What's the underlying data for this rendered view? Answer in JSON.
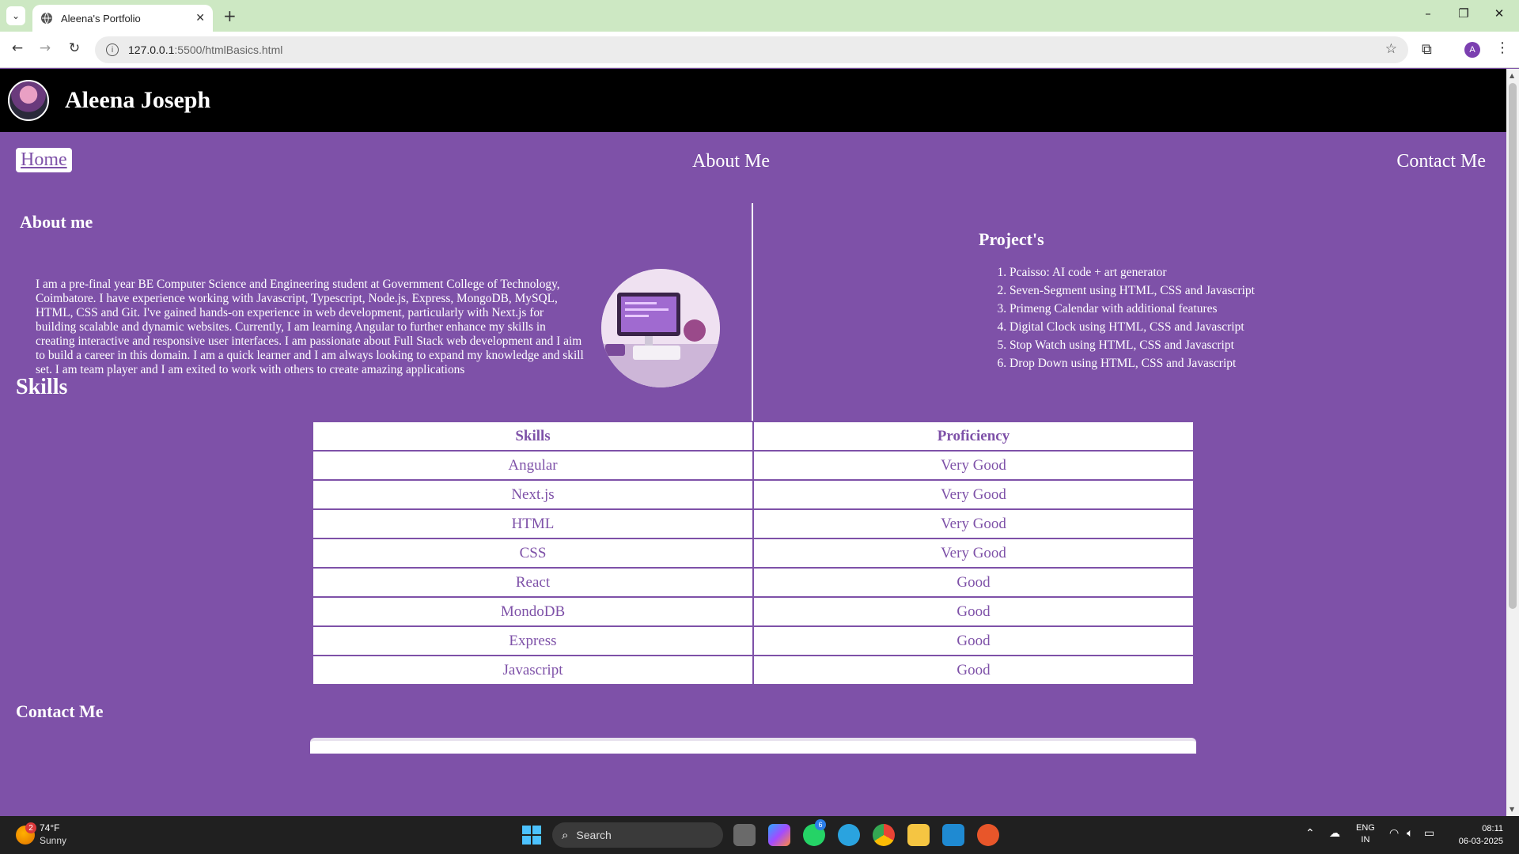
{
  "browser": {
    "tab_title": "Aleena's Portfolio",
    "new_tab": "+",
    "url_host": "127.0.0.1",
    "url_path": ":5500/htmlBasics.html",
    "profile_initial": "A"
  },
  "header": {
    "name": "Aleena Joseph"
  },
  "nav": {
    "home": "Home",
    "about": "About Me",
    "contact": "Contact Me"
  },
  "about": {
    "title": "About me",
    "text": "I am a pre-final year BE Computer Science and Engineering student at Government College of Technology, Coimbatore. I have experience working with Javascript, Typescript, Node.js, Express, MongoDB, MySQL, HTML, CSS and Git. I've gained hands-on experience in web development, particularly with Next.js for building scalable and dynamic websites. Currently, I am learning Angular to further enhance my skills in creating interactive and responsive user interfaces. I am passionate about Full Stack web development and I aim to build a career in this domain. I am a quick learner and I am always looking to expand my knowledge and skill set. I am team player and I am exited to work with others to create amazing applications"
  },
  "projects": {
    "title": "Project's",
    "items": [
      "Pcaisso: AI code + art generator",
      "Seven-Segment using HTML, CSS and Javascript",
      "Primeng Calendar with additional features",
      "Digital Clock using HTML, CSS and Javascript",
      "Stop Watch using HTML, CSS and Javascript",
      "Drop Down using HTML, CSS and Javascript"
    ]
  },
  "skills": {
    "title": "Skills",
    "headers": [
      "Skills",
      "Proficiency"
    ],
    "rows": [
      [
        "Angular",
        "Very Good"
      ],
      [
        "Next.js",
        "Very Good"
      ],
      [
        "HTML",
        "Very Good"
      ],
      [
        "CSS",
        "Very Good"
      ],
      [
        "React",
        "Good"
      ],
      [
        "MondoDB",
        "Good"
      ],
      [
        "Express",
        "Good"
      ],
      [
        "Javascript",
        "Good"
      ]
    ]
  },
  "contact": {
    "title": "Contact Me"
  },
  "taskbar": {
    "weather_badge": "2",
    "weather_temp": "74°F",
    "weather_desc": "Sunny",
    "search_label": "Search",
    "whatsapp_badge": "6",
    "lang_line1": "ENG",
    "lang_line2": "IN",
    "time": "08:11",
    "date": "06-03-2025"
  },
  "colors": {
    "page_bg": "#7e51a8",
    "header_bg": "#000000",
    "tabbar_bg": "#cde8c3"
  }
}
